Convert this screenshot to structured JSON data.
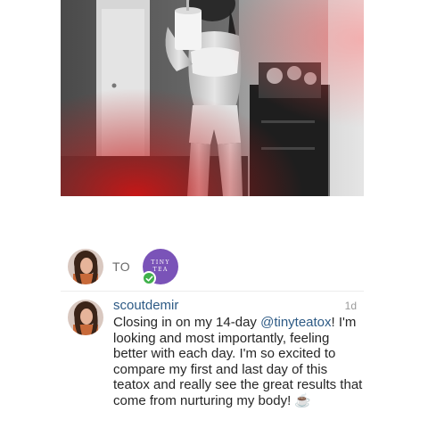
{
  "attribution": {
    "to_label": "TO",
    "brand": {
      "line1": "TINY",
      "line2": "TEA",
      "color": "#7a53b8"
    },
    "verified_color": "#3fb14a"
  },
  "comment": {
    "username": "scoutdemir",
    "time": "1d",
    "text_before": "Closing in on my 14-day ",
    "mention": "@tinyteatox",
    "text_after": "! I'm looking and most importantly, feeling better with each day. I'm so excited to compare my first and last day of this teatox and really see the great results that come from nurturing my body! ☕"
  },
  "colors": {
    "link": "#2d5a85",
    "text": "#262626",
    "muted": "#9a9a9a"
  }
}
